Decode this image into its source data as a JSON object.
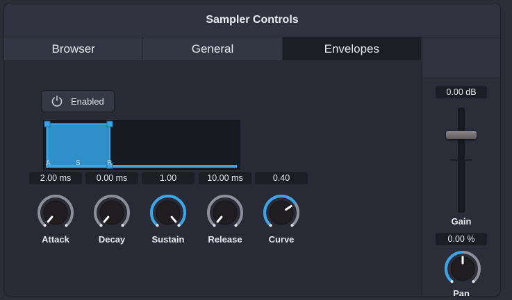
{
  "window": {
    "title": "Sampler Controls"
  },
  "tabs": [
    {
      "label": "Browser",
      "active": false
    },
    {
      "label": "General",
      "active": false
    },
    {
      "label": "Envelopes",
      "active": true
    }
  ],
  "envelope": {
    "enabled_label": "Enabled",
    "markers": {
      "attack": "A",
      "sustain": "S",
      "release": "R"
    },
    "controls": [
      {
        "name": "Attack",
        "value": "2.00 ms",
        "level": 0.0
      },
      {
        "name": "Decay",
        "value": "0.00 ms",
        "level": 0.0
      },
      {
        "name": "Sustain",
        "value": "1.00",
        "level": 1.0
      },
      {
        "name": "Release",
        "value": "10.00 ms",
        "level": 0.0
      },
      {
        "name": "Curve",
        "value": "0.40",
        "level": 0.7
      }
    ]
  },
  "mixer": {
    "gain": {
      "label": "Gain",
      "value": "0.00 dB"
    },
    "pan": {
      "label": "Pan",
      "value": "0.00 %",
      "level": 0.5
    }
  },
  "colors": {
    "accent": "#3aa6e8",
    "envelope_fill": "#2e8fc9",
    "background": "#282b35"
  }
}
